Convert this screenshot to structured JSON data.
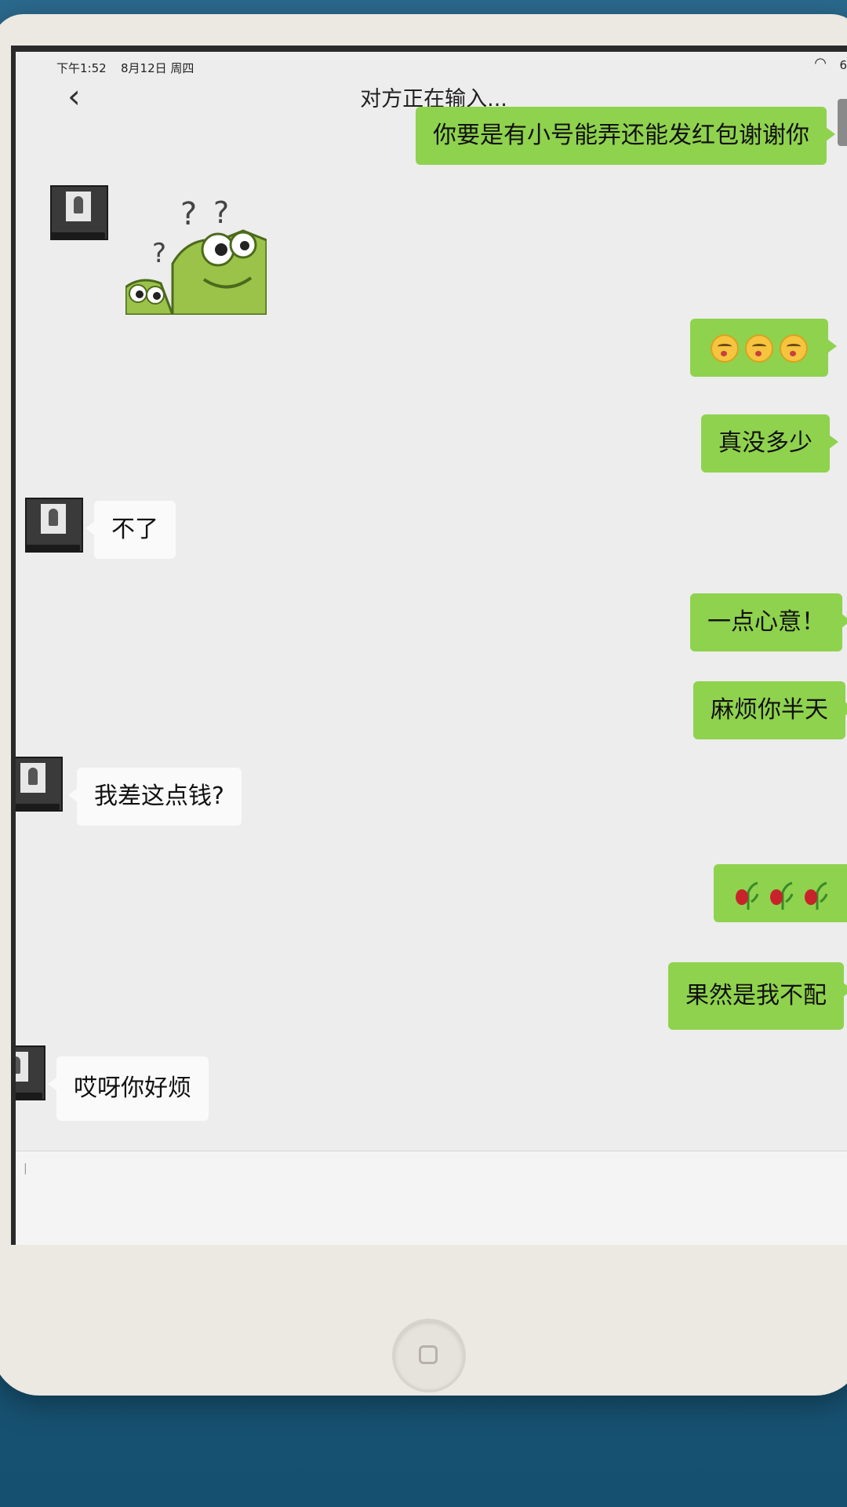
{
  "status": {
    "time": "下午1:52",
    "date": "8月12日 周四",
    "battery": "6"
  },
  "header": {
    "title": "对方正在输入..."
  },
  "messages": [
    {
      "side": "out",
      "text": "你要是有小号能弄还能发红包谢谢你"
    },
    {
      "side": "in",
      "type": "sticker",
      "sticker": "frog-question-sticker"
    },
    {
      "side": "out",
      "type": "emoji",
      "emoji": "kissing-face",
      "count": 3
    },
    {
      "side": "out",
      "text": "真没多少"
    },
    {
      "side": "in",
      "text": "不了"
    },
    {
      "side": "out",
      "text": "一点心意！"
    },
    {
      "side": "out",
      "text": "麻烦你半天"
    },
    {
      "side": "in",
      "text": "我差这点钱?"
    },
    {
      "side": "out",
      "type": "emoji",
      "emoji": "wilted-rose",
      "count": 3
    },
    {
      "side": "out",
      "text": "果然是我不配"
    },
    {
      "side": "in",
      "text": "哎呀你好烦"
    }
  ],
  "colors": {
    "outgoing_bubble": "#8fd24e",
    "incoming_bubble": "#fafafa",
    "chat_background": "#ecedec"
  }
}
